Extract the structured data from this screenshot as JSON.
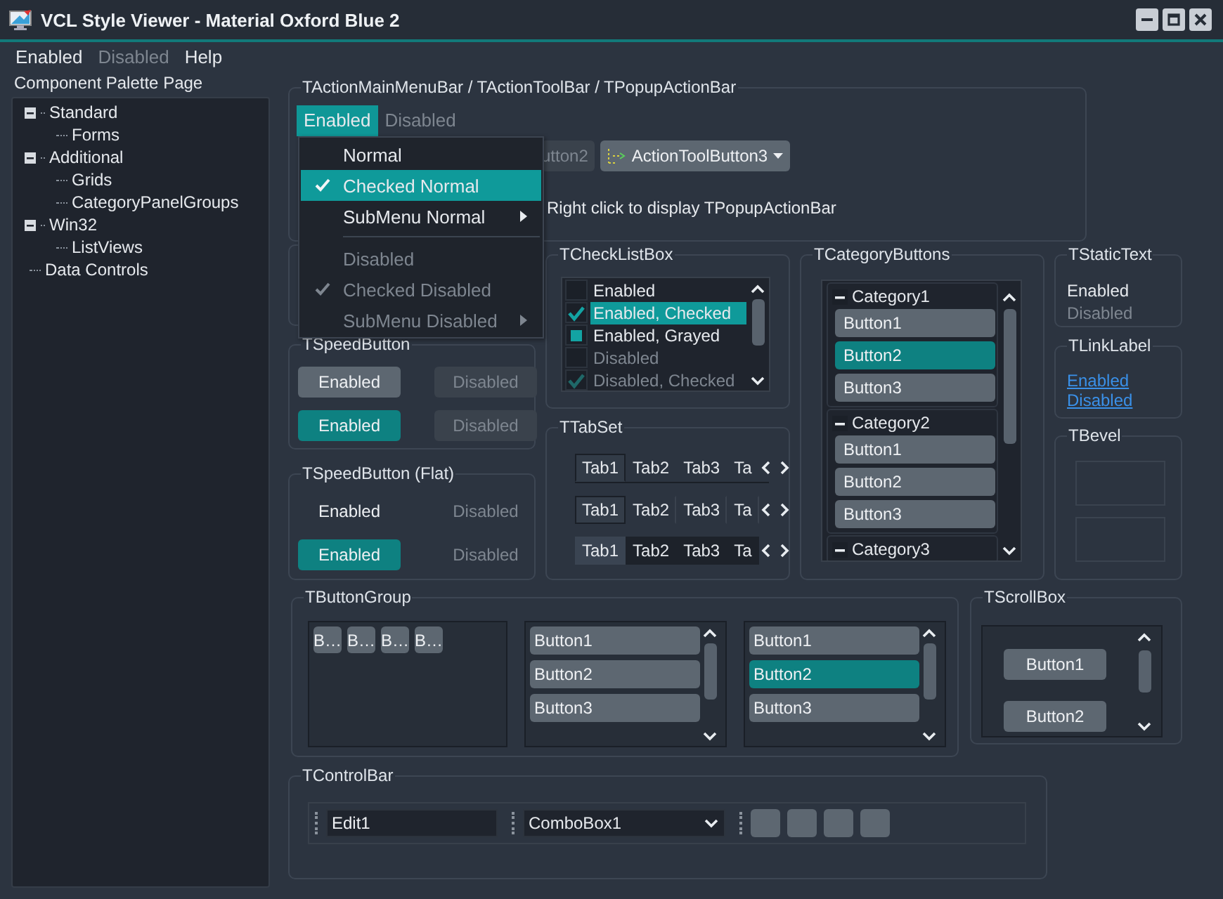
{
  "window": {
    "title": "VCL Style Viewer - Material Oxford Blue 2"
  },
  "menu_bar": [
    {
      "label": "Enabled",
      "disabled": false
    },
    {
      "label": "Disabled",
      "disabled": true
    },
    {
      "label": "Help",
      "disabled": false
    }
  ],
  "palette": {
    "title": "Component Palette Page",
    "tree": [
      {
        "label": "Standard",
        "expanded": true,
        "children": [
          {
            "label": "Forms"
          }
        ]
      },
      {
        "label": "Additional",
        "expanded": true,
        "children": [
          {
            "label": "Grids"
          },
          {
            "label": "CategoryPanelGroups"
          }
        ]
      },
      {
        "label": "Win32",
        "expanded": true,
        "children": [
          {
            "label": "ListViews"
          }
        ]
      },
      {
        "label": "Data Controls"
      }
    ]
  },
  "action_bars": {
    "title": "TActionMainMenuBar / TActionToolBar / TPopupActionBar",
    "menu": [
      {
        "label": "Enabled",
        "selected": true
      },
      {
        "label": "Disabled",
        "selected": false
      }
    ],
    "toolbar": [
      {
        "label": "utton2",
        "disabled": true,
        "dropdown": false
      },
      {
        "label": "ActionToolButton3",
        "disabled": false,
        "dropdown": true
      }
    ],
    "hint": "Right click to display TPopupActionBar",
    "popup": [
      {
        "kind": "item",
        "label": "Normal",
        "checked": false,
        "disabled": false,
        "submenu": false,
        "selected": false
      },
      {
        "kind": "item",
        "label": "Checked Normal",
        "checked": true,
        "disabled": false,
        "submenu": false,
        "selected": true
      },
      {
        "kind": "item",
        "label": "SubMenu Normal",
        "checked": false,
        "disabled": false,
        "submenu": true,
        "selected": false
      },
      {
        "kind": "separator"
      },
      {
        "kind": "item",
        "label": "Disabled",
        "checked": false,
        "disabled": true,
        "submenu": false,
        "selected": false
      },
      {
        "kind": "item",
        "label": "Checked Disabled",
        "checked": true,
        "disabled": true,
        "submenu": false,
        "selected": false
      },
      {
        "kind": "item",
        "label": "SubMenu Disabled",
        "checked": false,
        "disabled": true,
        "submenu": true,
        "selected": false
      }
    ]
  },
  "speed_buttons": {
    "title": "TSpeedButton",
    "buttons": [
      {
        "label": "Enabled",
        "disabled": false,
        "down": false
      },
      {
        "label": "Disabled",
        "disabled": true,
        "down": false
      },
      {
        "label": "Enabled",
        "disabled": false,
        "down": true
      },
      {
        "label": "Disabled",
        "disabled": true,
        "down": false
      }
    ]
  },
  "flat_speed_buttons": {
    "title": "TSpeedButton (Flat)",
    "buttons": [
      {
        "label": "Enabled",
        "disabled": false,
        "down": false
      },
      {
        "label": "Disabled",
        "disabled": true,
        "down": false
      },
      {
        "label": "Enabled",
        "disabled": false,
        "down": true
      },
      {
        "label": "Disabled",
        "disabled": true,
        "down": false
      }
    ]
  },
  "check_list_box": {
    "title": "TCheckListBox",
    "items": [
      {
        "label": "Enabled",
        "checked": false,
        "grayed": false,
        "disabled": false,
        "selected": false
      },
      {
        "label": "Enabled, Checked",
        "checked": true,
        "grayed": false,
        "disabled": false,
        "selected": true
      },
      {
        "label": "Enabled, Grayed",
        "checked": false,
        "grayed": true,
        "disabled": false,
        "selected": false
      },
      {
        "label": "Disabled",
        "checked": false,
        "grayed": false,
        "disabled": true,
        "selected": false
      },
      {
        "label": "Disabled, Checked",
        "checked": true,
        "grayed": false,
        "disabled": true,
        "selected": false
      }
    ]
  },
  "tab_set": {
    "title": "TTabSet",
    "rows": [
      {
        "kind": "slanted",
        "tabs": [
          {
            "label": "Tab1",
            "selected": true
          },
          {
            "label": "Tab2",
            "selected": false
          },
          {
            "label": "Tab3",
            "selected": false
          },
          {
            "label": "Ta",
            "selected": false
          }
        ]
      },
      {
        "kind": "flat",
        "tabs": [
          {
            "label": "Tab1",
            "selected": true
          },
          {
            "label": "Tab2",
            "selected": false
          },
          {
            "label": "Tab3",
            "selected": false
          },
          {
            "label": "Ta",
            "selected": false
          }
        ]
      },
      {
        "kind": "boxed",
        "tabs": [
          {
            "label": "Tab1",
            "selected": true
          },
          {
            "label": "Tab2",
            "selected": false
          },
          {
            "label": "Tab3",
            "selected": false
          },
          {
            "label": "Ta",
            "selected": false
          }
        ]
      }
    ]
  },
  "category_buttons": {
    "title": "TCategoryButtons",
    "categories": [
      {
        "label": "Category1",
        "expanded": true,
        "buttons": [
          {
            "label": "Button1",
            "selected": false
          },
          {
            "label": "Button2",
            "selected": true
          },
          {
            "label": "Button3",
            "selected": false
          }
        ]
      },
      {
        "label": "Category2",
        "expanded": true,
        "buttons": [
          {
            "label": "Button1",
            "selected": false
          },
          {
            "label": "Button2",
            "selected": false
          },
          {
            "label": "Button3",
            "selected": false
          }
        ]
      },
      {
        "label": "Category3",
        "expanded": true
      }
    ]
  },
  "static_text": {
    "title": "TStaticText",
    "items": [
      {
        "label": "Enabled",
        "disabled": false
      },
      {
        "label": "Disabled",
        "disabled": true
      }
    ]
  },
  "link_label": {
    "title": "TLinkLabel",
    "links": [
      "Enabled",
      "Disabled"
    ]
  },
  "bevel": {
    "title": "TBevel"
  },
  "button_group": {
    "title": "TButtonGroup",
    "panes": [
      {
        "kind": "compact",
        "buttons": [
          {
            "label": "B…",
            "selected": false
          },
          {
            "label": "B…",
            "selected": false
          },
          {
            "label": "B…",
            "selected": false
          },
          {
            "label": "B…",
            "selected": false
          }
        ]
      },
      {
        "kind": "list",
        "buttons": [
          {
            "label": "Button1",
            "selected": false
          },
          {
            "label": "Button2",
            "selected": false
          },
          {
            "label": "Button3",
            "selected": false
          }
        ]
      },
      {
        "kind": "list",
        "buttons": [
          {
            "label": "Button1",
            "selected": false
          },
          {
            "label": "Button2",
            "selected": true
          },
          {
            "label": "Button3",
            "selected": false
          }
        ]
      }
    ]
  },
  "scroll_box": {
    "title": "TScrollBox",
    "buttons": [
      "Button1",
      "Button2"
    ]
  },
  "control_bar": {
    "title": "TControlBar",
    "edit": {
      "value": "Edit1"
    },
    "combo": {
      "value": "ComboBox1"
    }
  }
}
